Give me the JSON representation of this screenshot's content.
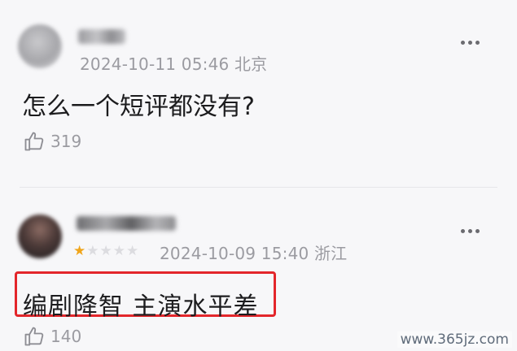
{
  "comments": [
    {
      "meta": "2024-10-11 05:46 北京",
      "text": "怎么一个短评都没有?",
      "likes": "319",
      "stars": null
    },
    {
      "meta": "2024-10-09 15:40 浙江",
      "text": "编剧降智 主演水平差",
      "likes": "140",
      "stars": {
        "filled": 1,
        "total": 5
      }
    }
  ],
  "watermark": "www.365jz.com",
  "colors": {
    "accent_highlight": "#e3262b",
    "star_on": "#f0a51b",
    "meta_gray": "#9b9ba1"
  }
}
